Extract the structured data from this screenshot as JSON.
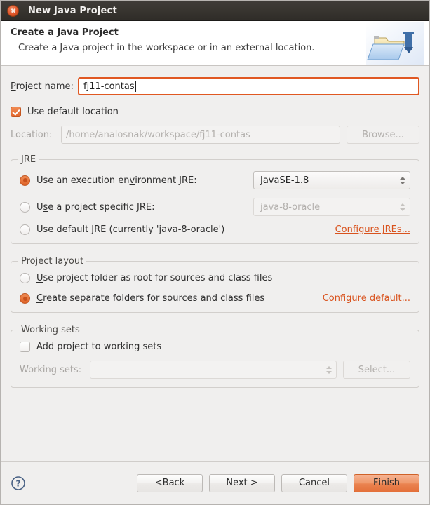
{
  "window": {
    "title": "New Java Project",
    "close_icon": "close-icon"
  },
  "header": {
    "title": "Create a Java Project",
    "description": "Create a Java project in the workspace or in an external location.",
    "icon": "java-project-folder-icon"
  },
  "project_name": {
    "label": "Project name:",
    "label_mnemonic": "P",
    "label_rest": "roject name:",
    "value": "fj11-contas"
  },
  "location": {
    "checkbox_label_pre": "Use ",
    "checkbox_label_mnemonic": "d",
    "checkbox_label_post": "efault location",
    "checkbox_checked": true,
    "label": "Location:",
    "value": "/home/analosnak/workspace/fj11-contas",
    "browse_label": "Browse...",
    "enabled": false
  },
  "jre": {
    "group_title": "JRE",
    "options": [
      {
        "label_pre": "Use an execution en",
        "label_mnemonic": "v",
        "label_post": "ironment JRE:",
        "selected": true
      },
      {
        "label_pre": "U",
        "label_mnemonic": "s",
        "label_post": "e a project specific JRE:",
        "selected": false
      },
      {
        "label_pre": "Use def",
        "label_mnemonic": "a",
        "label_post": "ult JRE (currently 'java-8-oracle')",
        "selected": false
      }
    ],
    "execution_env_value": "JavaSE-1.8",
    "project_jre_value": "java-8-oracle",
    "configure_link": "Configure JREs..."
  },
  "project_layout": {
    "group_title": "Project layout",
    "options": [
      {
        "label_pre": "",
        "label_mnemonic": "U",
        "label_post": "se project folder as root for sources and class files",
        "selected": false
      },
      {
        "label_pre": "",
        "label_mnemonic": "C",
        "label_post": "reate separate folders for sources and class files",
        "selected": true
      }
    ],
    "configure_link": "Configure default..."
  },
  "working_sets": {
    "group_title": "Working sets",
    "checkbox_label_pre": "Add proje",
    "checkbox_label_mnemonic": "c",
    "checkbox_label_post": "t to working sets",
    "checkbox_checked": false,
    "label": "Working sets:",
    "value": "",
    "select_label": "Select...",
    "enabled": false
  },
  "footer": {
    "help_icon": "help-icon",
    "back_pre": "< ",
    "back_mnemonic": "B",
    "back_post": "ack",
    "next_mnemonic": "N",
    "next_post": "ext >",
    "cancel_label": "Cancel",
    "finish_mnemonic": "F",
    "finish_post": "inish"
  },
  "colors": {
    "accent": "#e05822",
    "link": "#d9531e",
    "titlebar": "#37342f",
    "body_bg": "#f0efee"
  }
}
